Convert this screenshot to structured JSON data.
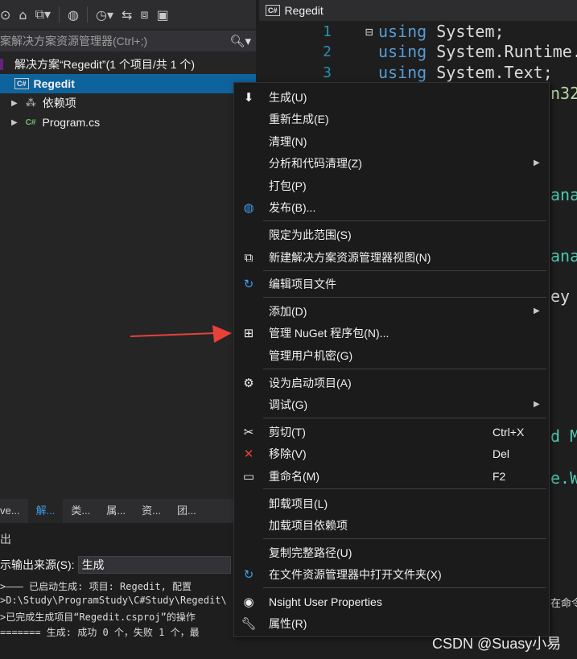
{
  "left_panel": {
    "search_placeholder": "案解决方案资源管理器(Ctrl+;)",
    "solution_label": "解决方案“Regedit”(1 个项目/共 1 个)",
    "project_label": "Regedit",
    "project_badge": "C#",
    "deps_label": "依赖项",
    "program_label": "Program.cs",
    "program_badge": "C#",
    "tabs": [
      "ve...",
      "解...",
      "类...",
      "属...",
      "资...",
      "团..."
    ]
  },
  "editor": {
    "tab_title": "Regedit",
    "tab_badge": "C#",
    "lines": [
      {
        "num": "1",
        "kw": "using",
        "rest": "System;"
      },
      {
        "num": "2",
        "kw": "using",
        "rest": "System.Runtime."
      },
      {
        "num": "3",
        "kw": "using",
        "rest": "System.Text;"
      }
    ],
    "fragments": [
      "n32",
      "anag",
      "anag",
      "ey H",
      "d M",
      "e.W"
    ]
  },
  "output": {
    "header": "出",
    "source_label": "示输出来源(S):",
    "source_value": "生成",
    "lines": [
      ">——— 已启动生成: 项目: Regedit, 配置",
      ">D:\\Study\\ProgramStudy\\C#Study\\Regedit\\",
      ">已完成生成项目“Regedit.csproj”的操作",
      "======= 生成: 成功 0 个，失败 1 个，最"
    ],
    "right_fragment": "在命令"
  },
  "context_menu": {
    "items": [
      {
        "icon": "build-icon",
        "label": "生成(U)"
      },
      {
        "label": "重新生成(E)"
      },
      {
        "label": "清理(N)"
      },
      {
        "label": "分析和代码清理(Z)",
        "submenu": true
      },
      {
        "label": "打包(P)"
      },
      {
        "icon": "globe-icon",
        "label": "发布(B)..."
      },
      {
        "label": "限定为此范围(S)"
      },
      {
        "icon": "new-view-icon",
        "label": "新建解决方案资源管理器视图(N)"
      },
      {
        "icon": "edit-refresh-icon",
        "label": "编辑项目文件"
      },
      {
        "label": "添加(D)",
        "submenu": true
      },
      {
        "icon": "nuget-icon",
        "label": "管理 NuGet 程序包(N)..."
      },
      {
        "label": "管理用户机密(G)"
      },
      {
        "icon": "gear-icon",
        "label": "设为启动项目(A)"
      },
      {
        "label": "调试(G)",
        "submenu": true
      },
      {
        "icon": "scissors-icon",
        "label": "剪切(T)",
        "shortcut": "Ctrl+X"
      },
      {
        "icon": "remove-icon",
        "label": "移除(V)",
        "shortcut": "Del"
      },
      {
        "icon": "rename-icon",
        "label": "重命名(M)",
        "shortcut": "F2"
      },
      {
        "label": "卸载项目(L)"
      },
      {
        "label": "加载项目依赖项"
      },
      {
        "label": "复制完整路径(U)"
      },
      {
        "icon": "open-folder-icon",
        "label": "在文件资源管理器中打开文件夹(X)"
      },
      {
        "icon": "nsight-icon",
        "label": "Nsight User Properties"
      },
      {
        "icon": "wrench-icon",
        "label": "属性(R)"
      }
    ]
  },
  "colors": {
    "selection": "#0e639c",
    "arrow": "#e8413a",
    "keyword": "#569cd6"
  },
  "watermark": "CSDN @Suasy小易"
}
